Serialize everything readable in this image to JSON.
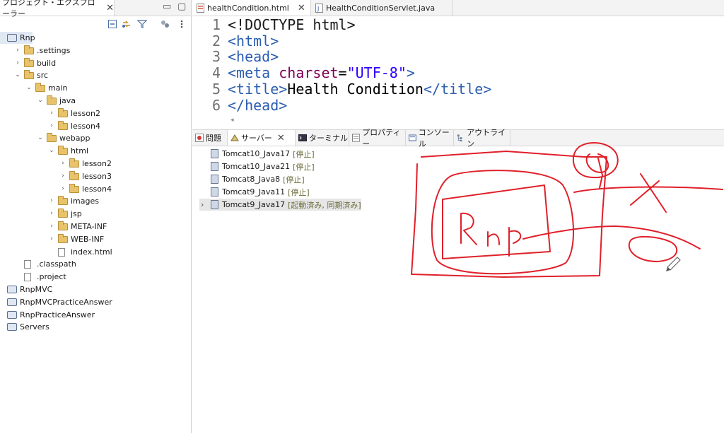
{
  "explorer": {
    "tab_label": "プロジェクト・エクスプローラー",
    "tab_close": "✕",
    "minimize": "▭",
    "maximize": "▢",
    "tree": [
      {
        "label": "Rnp",
        "type": "project",
        "depth": 0,
        "expanded": true,
        "selected": true
      },
      {
        "label": ".settings",
        "type": "folder",
        "depth": 1,
        "expanded": false
      },
      {
        "label": "build",
        "type": "folder",
        "depth": 1,
        "expanded": false
      },
      {
        "label": "src",
        "type": "folder",
        "depth": 1,
        "expanded": true
      },
      {
        "label": "main",
        "type": "folder",
        "depth": 2,
        "expanded": true
      },
      {
        "label": "java",
        "type": "folder",
        "depth": 3,
        "expanded": true
      },
      {
        "label": "lesson2",
        "type": "folder",
        "depth": 4,
        "expanded": false
      },
      {
        "label": "lesson4",
        "type": "folder",
        "depth": 4,
        "expanded": false
      },
      {
        "label": "webapp",
        "type": "folder",
        "depth": 3,
        "expanded": true
      },
      {
        "label": "html",
        "type": "folder",
        "depth": 4,
        "expanded": true
      },
      {
        "label": "lesson2",
        "type": "folder",
        "depth": 5,
        "expanded": false
      },
      {
        "label": "lesson3",
        "type": "folder",
        "depth": 5,
        "expanded": false
      },
      {
        "label": "lesson4",
        "type": "folder",
        "depth": 5,
        "expanded": false
      },
      {
        "label": "images",
        "type": "folder",
        "depth": 4,
        "expanded": false
      },
      {
        "label": "jsp",
        "type": "folder",
        "depth": 4,
        "expanded": false
      },
      {
        "label": "META-INF",
        "type": "folder",
        "depth": 4,
        "expanded": false
      },
      {
        "label": "WEB-INF",
        "type": "folder",
        "depth": 4,
        "expanded": false
      },
      {
        "label": "index.html",
        "type": "file",
        "depth": 4
      },
      {
        "label": ".classpath",
        "type": "file",
        "depth": 1
      },
      {
        "label": ".project",
        "type": "file",
        "depth": 1
      },
      {
        "label": "RnpMVC",
        "type": "project",
        "depth": 0
      },
      {
        "label": "RnpMVCPracticeAnswer",
        "type": "project",
        "depth": 0
      },
      {
        "label": "RnpPracticeAnswer",
        "type": "project",
        "depth": 0
      },
      {
        "label": "Servers",
        "type": "project",
        "depth": 0
      }
    ]
  },
  "editor": {
    "tabs": [
      {
        "label": "healthCondition.html",
        "active": true,
        "close": "✕"
      },
      {
        "label": "HealthConditionServlet.java",
        "active": false
      }
    ],
    "lines": [
      {
        "num": "1",
        "segments": [
          {
            "t": "<!DOCTYPE html>",
            "c": "dt"
          }
        ]
      },
      {
        "num": "2",
        "segments": [
          {
            "t": "<",
            "c": "tag"
          },
          {
            "t": "html",
            "c": "tag"
          },
          {
            "t": ">",
            "c": "tag"
          }
        ]
      },
      {
        "num": "3",
        "segments": [
          {
            "t": "<",
            "c": "tag"
          },
          {
            "t": "head",
            "c": "tag"
          },
          {
            "t": ">",
            "c": "tag"
          }
        ]
      },
      {
        "num": "4",
        "segments": [
          {
            "t": "<",
            "c": "tag"
          },
          {
            "t": "meta",
            "c": "tag"
          },
          {
            "t": " charset",
            "c": "attr"
          },
          {
            "t": "=",
            "c": "txt"
          },
          {
            "t": "\"UTF-8\"",
            "c": "str"
          },
          {
            "t": ">",
            "c": "tag"
          }
        ]
      },
      {
        "num": "5",
        "segments": [
          {
            "t": "<",
            "c": "tag"
          },
          {
            "t": "title",
            "c": "tag"
          },
          {
            "t": ">",
            "c": "tag"
          },
          {
            "t": "Health Condition",
            "c": "txt"
          },
          {
            "t": "</",
            "c": "tag"
          },
          {
            "t": "title",
            "c": "tag"
          },
          {
            "t": ">",
            "c": "tag"
          }
        ]
      },
      {
        "num": "6",
        "segments": [
          {
            "t": "</",
            "c": "tag"
          },
          {
            "t": "head",
            "c": "tag"
          },
          {
            "t": ">",
            "c": "tag"
          }
        ]
      }
    ],
    "scroll_marker": "◂"
  },
  "views": {
    "tabs": [
      {
        "label": "問題",
        "icon": "problems-icon"
      },
      {
        "label": "サーバー",
        "icon": "servers-icon",
        "active": true,
        "close": "✕"
      },
      {
        "label": "ターミナル",
        "icon": "terminal-icon"
      },
      {
        "label": "プロパティー",
        "icon": "properties-icon"
      },
      {
        "label": "コンソール",
        "icon": "console-icon"
      },
      {
        "label": "アウトライン",
        "icon": "outline-icon"
      }
    ],
    "servers": [
      {
        "name": "Tomcat10_Java17",
        "state": "[停止]"
      },
      {
        "name": "Tomcat10_Java21",
        "state": "[停止]"
      },
      {
        "name": "Tomcat8_Java8",
        "state": "[停止]"
      },
      {
        "name": "Tomcat9_Java11",
        "state": "[停止]"
      },
      {
        "name": "Tomcat9_Java17",
        "state": "[起動済み, 同期済み]",
        "selected": true,
        "expandable": true
      }
    ]
  },
  "annotation": {
    "ink_color": "#e0202a"
  }
}
